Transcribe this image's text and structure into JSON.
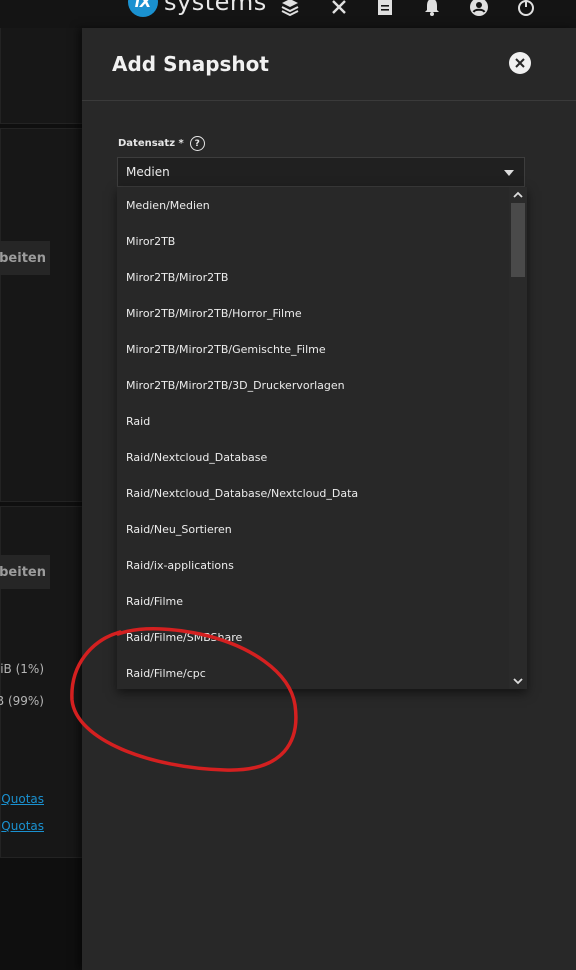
{
  "header": {
    "brand_word": "systems",
    "brand_badge": "iX"
  },
  "background": {
    "button_1": "beiten",
    "button_2": "beiten",
    "usage_1": "iB (1%)",
    "usage_2": "B (99%)",
    "link_1": "Quotas",
    "link_2": "Quotas"
  },
  "panel": {
    "title": "Add Snapshot",
    "dataset_label": "Datensatz *",
    "dataset_value": "Medien",
    "options": [
      "Medien/Medien",
      "Miror2TB",
      "Miror2TB/Miror2TB",
      "Miror2TB/Miror2TB/Horror_Filme",
      "Miror2TB/Miror2TB/Gemischte_Filme",
      "Miror2TB/Miror2TB/3D_Druckervorlagen",
      "Raid",
      "Raid/Nextcloud_Database",
      "Raid/Nextcloud_Database/Nextcloud_Data",
      "Raid/Neu_Sortieren",
      "Raid/ix-applications",
      "Raid/Filme",
      "Raid/Filme/SMBShare",
      "Raid/Filme/cpc"
    ]
  },
  "colors": {
    "accent": "#1a91d0",
    "panel_bg": "#282828",
    "annotation": "#d42020"
  },
  "icons": [
    "ix-logo-icon",
    "layers-icon",
    "network-icon",
    "clipboard-icon",
    "bell-icon",
    "account-icon",
    "power-icon",
    "close-icon",
    "help-icon",
    "chevron-down-icon",
    "scroll-up-icon",
    "scroll-down-icon"
  ]
}
